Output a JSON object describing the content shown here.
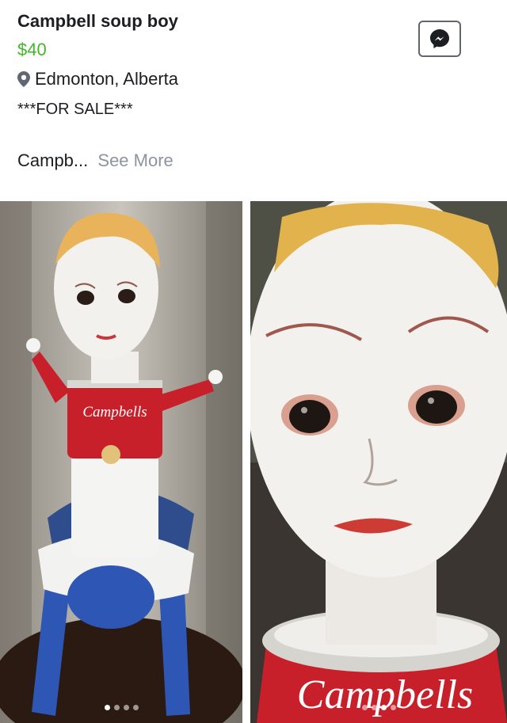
{
  "listing": {
    "title": "Campbell soup boy",
    "price": "$40",
    "location": "Edmonton, Alberta",
    "description": "***FOR SALE***",
    "snippet": "Campb...",
    "see_more": "See More"
  },
  "icons": {
    "location": "location-pin-icon",
    "messenger": "messenger-icon"
  },
  "photos": [
    {
      "label_text": "Campbells",
      "carousel_active_index": 1,
      "carousel_count": 4
    },
    {
      "label_text": "Campbells",
      "carousel_active_index": 3,
      "carousel_count": 4
    }
  ],
  "colors": {
    "price": "#42b72a",
    "secondary_text": "#8d949e",
    "can_red": "#c8202a",
    "doll_blue": "#2e56b5"
  }
}
